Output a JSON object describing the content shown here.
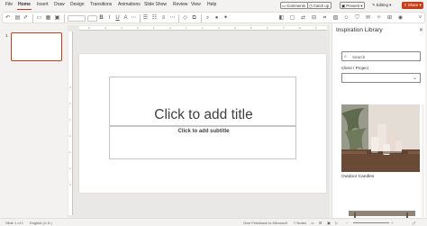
{
  "tabs": [
    "File",
    "Home",
    "Insert",
    "Draw",
    "Design",
    "Transitions",
    "Animations",
    "Slide Show",
    "Review",
    "View",
    "Help"
  ],
  "active_tab": "Home",
  "top_actions": {
    "comments": "Comments",
    "catch_up": "Catch up",
    "present": "Present",
    "editing": "Editing",
    "share": "Share"
  },
  "colors": {
    "accent": "#c43e1c",
    "panel_bg": "#ffffff",
    "app_bg": "#f3f2f1"
  },
  "thumbnails": {
    "slide_number": "1"
  },
  "slide": {
    "title_placeholder": "Click to add title",
    "subtitle_placeholder": "Click to add subtitle"
  },
  "ruler": {
    "top_ticks": [
      "5",
      "4",
      "3",
      "2",
      "1",
      "0",
      "1",
      "2",
      "3",
      "4",
      "5",
      "6",
      "7",
      "8",
      "9"
    ],
    "left_ticks": [
      "3",
      "2",
      "1",
      "0",
      "1",
      "2",
      "3"
    ]
  },
  "inspiration_panel": {
    "title": "Inspiration Library",
    "search_placeholder": "Search",
    "client_label": "Client / Project",
    "image_caption": "Outdoor Candles"
  },
  "icons": {
    "close": "close-icon",
    "search": "search-icon",
    "chevron": "chevron-down-icon"
  },
  "status_bar": {
    "slide_info": "Slide 1 of 1",
    "language": "English (U.S.)",
    "feedback": "Give Feedback to Microsoft",
    "notes": "Notes"
  }
}
